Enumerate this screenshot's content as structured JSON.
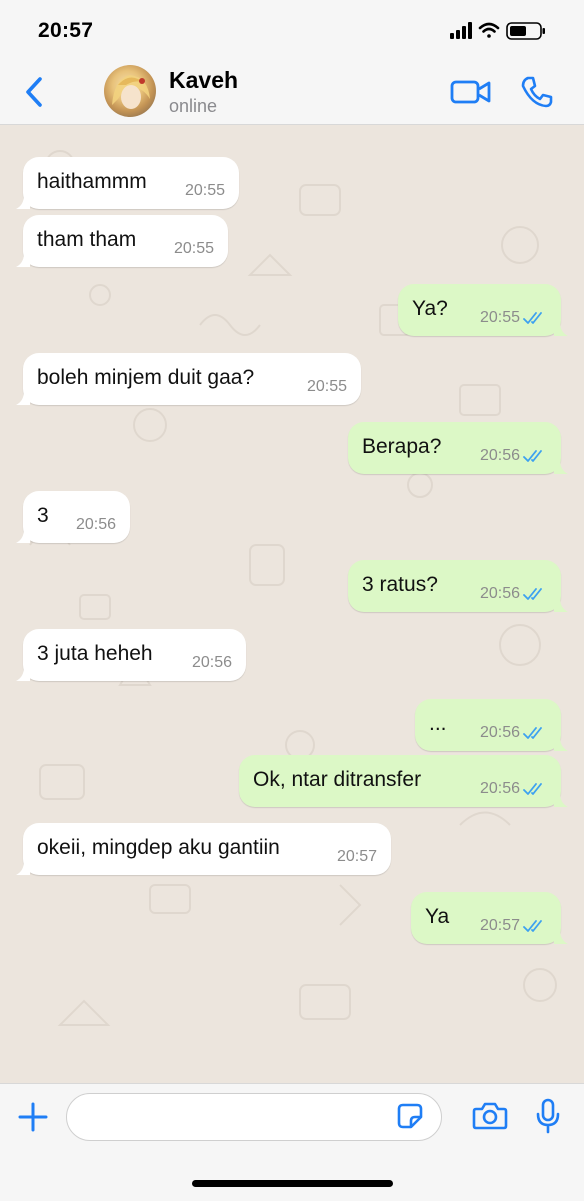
{
  "status_bar": {
    "time": "20:57"
  },
  "header": {
    "contact_name": "Kaveh",
    "contact_status": "online"
  },
  "colors": {
    "accent": "#1f7ef5",
    "incoming_bubble": "#ffffff",
    "outgoing_bubble": "#dcf8c6",
    "chat_background": "#ece5dd",
    "read_ticks": "#3da1f0"
  },
  "messages": [
    {
      "direction": "in",
      "text": "haithammm",
      "time": "20:55"
    },
    {
      "direction": "in",
      "text": "tham tham",
      "time": "20:55"
    },
    {
      "direction": "out",
      "text": "Ya?",
      "time": "20:55",
      "status": "read"
    },
    {
      "direction": "in",
      "text": "boleh minjem duit gaa?",
      "time": "20:55"
    },
    {
      "direction": "out",
      "text": "Berapa?",
      "time": "20:56",
      "status": "read"
    },
    {
      "direction": "in",
      "text": "3",
      "time": "20:56"
    },
    {
      "direction": "out",
      "text": "3 ratus?",
      "time": "20:56",
      "status": "read"
    },
    {
      "direction": "in",
      "text": "3 juta heheh",
      "time": "20:56"
    },
    {
      "direction": "out",
      "text": "...",
      "time": "20:56",
      "status": "read"
    },
    {
      "direction": "out",
      "text": "Ok, ntar ditransfer",
      "time": "20:56",
      "status": "read"
    },
    {
      "direction": "in",
      "text": "okeii, mingdep aku gantiin",
      "time": "20:57"
    },
    {
      "direction": "out",
      "text": "Ya",
      "time": "20:57",
      "status": "read"
    }
  ],
  "input_bar": {
    "message_placeholder": ""
  },
  "icons": {
    "back": "chevron-left-icon",
    "video_call": "video-camera-icon",
    "voice_call": "phone-icon",
    "attach": "plus-icon",
    "sticker": "sticker-icon",
    "camera": "camera-icon",
    "microphone": "microphone-icon"
  }
}
